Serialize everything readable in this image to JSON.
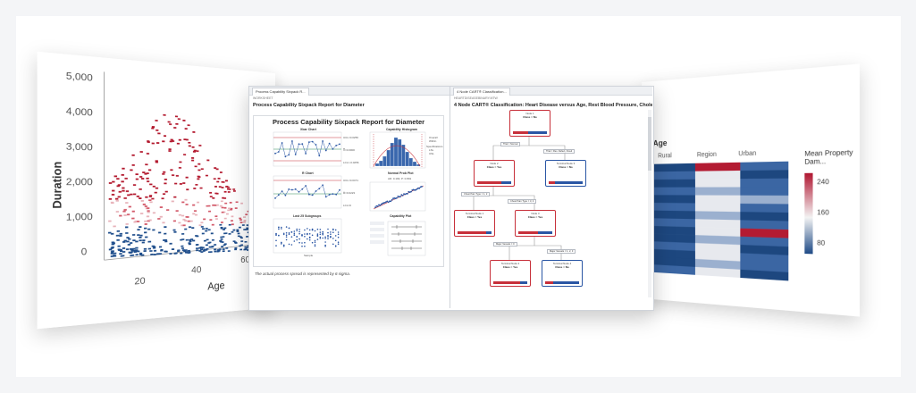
{
  "left_chart": {
    "ylabel": "Duration",
    "xlabel": "Age",
    "yticks": [
      "5,000",
      "4,000",
      "3,000",
      "2,000",
      "1,000",
      "0"
    ],
    "xticks": [
      "20",
      "40",
      "60"
    ]
  },
  "process_report": {
    "tab_label": "Process Capability Sixpack R...",
    "breadcrumb": "WORKSHEET",
    "title": "Process Capability Sixpack Report for Diameter",
    "chart_title": "Process Capability Sixpack Report for Diameter",
    "xbar_title": "Xbar Chart",
    "r_title": "R Chart",
    "last_title": "Last 25 Subgroups",
    "hist_title": "Capability Histogram",
    "prob_title": "Normal Prob Plot",
    "cap_title": "Capability Plot",
    "xbar_labels": [
      "UCL=0.0256",
      "X̿=0.0000",
      "LCL=-0.0256"
    ],
    "r_labels": [
      "UCL=0.0471",
      "R̄=0.0223",
      "LCL=0"
    ],
    "last_xlabel": "Sample",
    "hist_legend": [
      "Overall",
      "Within",
      "Specifications",
      "LSL",
      "USL"
    ],
    "prob_note": "AD: 0.193, P: 0.891",
    "footnote": "The actual process spread is represented by 6 sigma."
  },
  "cart_report": {
    "tab_label": "4 Node CART® Classification...",
    "breadcrumb": "HEARTDISEASEBINARY.MTW",
    "title": "4 Node CART® Classification: Heart Disease versus Age, Rest Blood Pressure, Cholester...",
    "root": {
      "name": "Node 1",
      "cls": "Class = No"
    },
    "nodes": [
      {
        "name": "Node 2",
        "cls": "Class = Yes"
      },
      {
        "name": "Terminal Node 3",
        "cls": "Class = No"
      },
      {
        "name": "Terminal Node 1",
        "cls": "Class = Yes"
      },
      {
        "name": "Node 3",
        "cls": "Class = Yes"
      },
      {
        "name": "Terminal Node 2",
        "cls": "Class = Yes"
      },
      {
        "name": "Terminal Node 4",
        "cls": "Class = No"
      }
    ],
    "splits": [
      "Thal = Normal",
      "Thal = Rev. Defect, Fixed",
      "Chest Pain Type = 1, 2",
      "Chest Pain Type = 3, 4",
      "Major Vessels = 0",
      "Major Vessels = 1, 2, 3"
    ]
  },
  "heatmap": {
    "title": "Age",
    "columns": [
      "Rural",
      "Region",
      "Urban"
    ],
    "legend_title": "Mean Property Dam...",
    "legend_ticks": [
      "240",
      "160",
      "80"
    ]
  }
}
